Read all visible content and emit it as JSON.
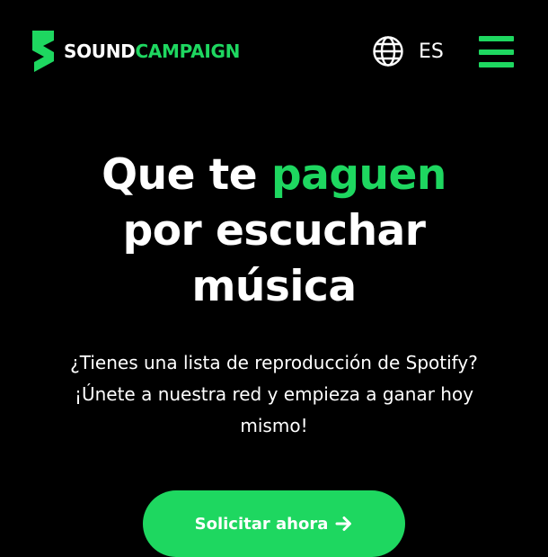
{
  "brand": {
    "name_part1": "SOUND",
    "name_part2": "CAMPAIGN",
    "icon": "soundcampaign-logo-icon"
  },
  "header": {
    "language_icon": "globe-icon",
    "language_code": "ES",
    "menu_icon": "hamburger-menu-icon"
  },
  "hero": {
    "title_part1": "Que te ",
    "title_accent": "paguen",
    "title_part2": "por escuchar",
    "title_part3": "música",
    "subtitle": "¿Tienes una lista de reproducción de Spotify? ¡Únete a nuestra red y empieza a ganar hoy mismo!",
    "cta_label": "Solicitar ahora",
    "cta_icon": "arrow-right-icon"
  },
  "colors": {
    "background": "#000000",
    "accent": "#1ed760",
    "text": "#ffffff"
  }
}
